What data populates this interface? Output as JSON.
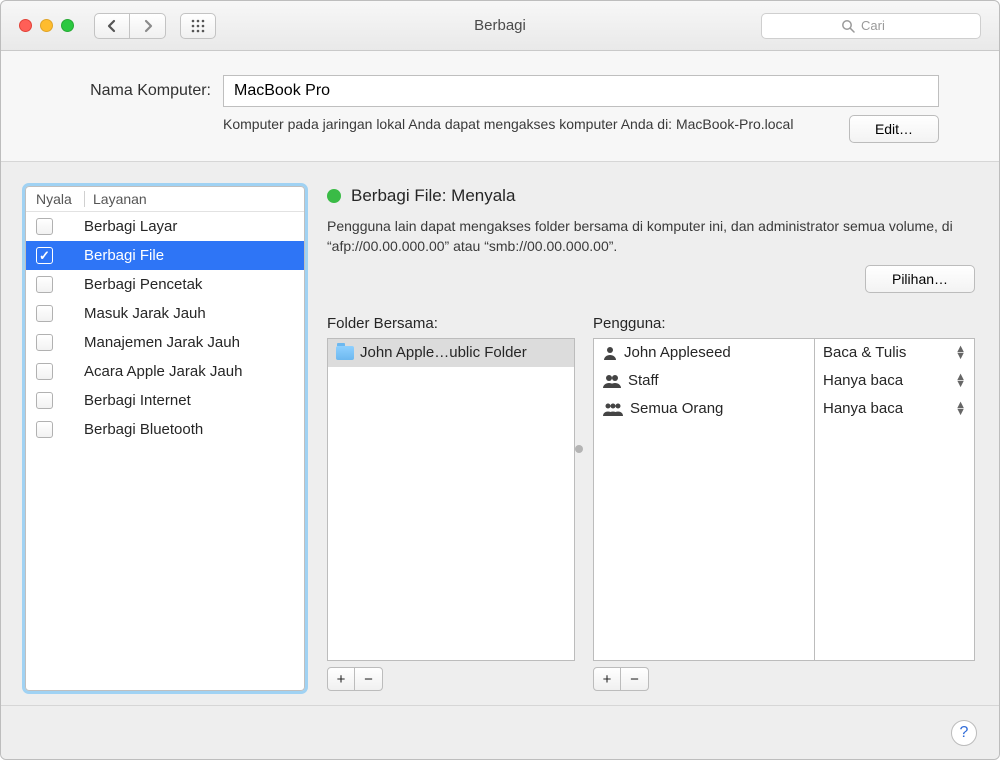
{
  "window": {
    "title": "Berbagi",
    "search_placeholder": "Cari"
  },
  "computer_name": {
    "label": "Nama Komputer:",
    "value": "MacBook Pro",
    "help_text": "Komputer pada jaringan lokal Anda dapat mengakses komputer Anda di: MacBook-Pro.local",
    "edit_button": "Edit…"
  },
  "services": {
    "col_on": "Nyala",
    "col_service": "Layanan",
    "items": [
      {
        "label": "Berbagi Layar",
        "on": false,
        "selected": false
      },
      {
        "label": "Berbagi File",
        "on": true,
        "selected": true
      },
      {
        "label": "Berbagi Pencetak",
        "on": false,
        "selected": false
      },
      {
        "label": "Masuk Jarak Jauh",
        "on": false,
        "selected": false
      },
      {
        "label": "Manajemen Jarak Jauh",
        "on": false,
        "selected": false
      },
      {
        "label": "Acara Apple Jarak Jauh",
        "on": false,
        "selected": false
      },
      {
        "label": "Berbagi Internet",
        "on": false,
        "selected": false
      },
      {
        "label": "Berbagi Bluetooth",
        "on": false,
        "selected": false
      }
    ]
  },
  "detail": {
    "status_title": "Berbagi File: Menyala",
    "status_desc": "Pengguna lain dapat mengakses folder bersama di komputer ini, dan administrator semua volume, di “afp://00.00.000.00” atau “smb://00.00.000.00”.",
    "options_button": "Pilihan…",
    "folders_label": "Folder Bersama:",
    "users_label": "Pengguna:",
    "folders": [
      {
        "label": "John Apple…ublic Folder",
        "selected": true
      }
    ],
    "users": [
      {
        "icon": "person",
        "label": "John Appleseed",
        "perm": "Baca & Tulis"
      },
      {
        "icon": "people2",
        "label": "Staff",
        "perm": "Hanya baca"
      },
      {
        "icon": "people3",
        "label": "Semua Orang",
        "perm": "Hanya baca"
      }
    ]
  }
}
